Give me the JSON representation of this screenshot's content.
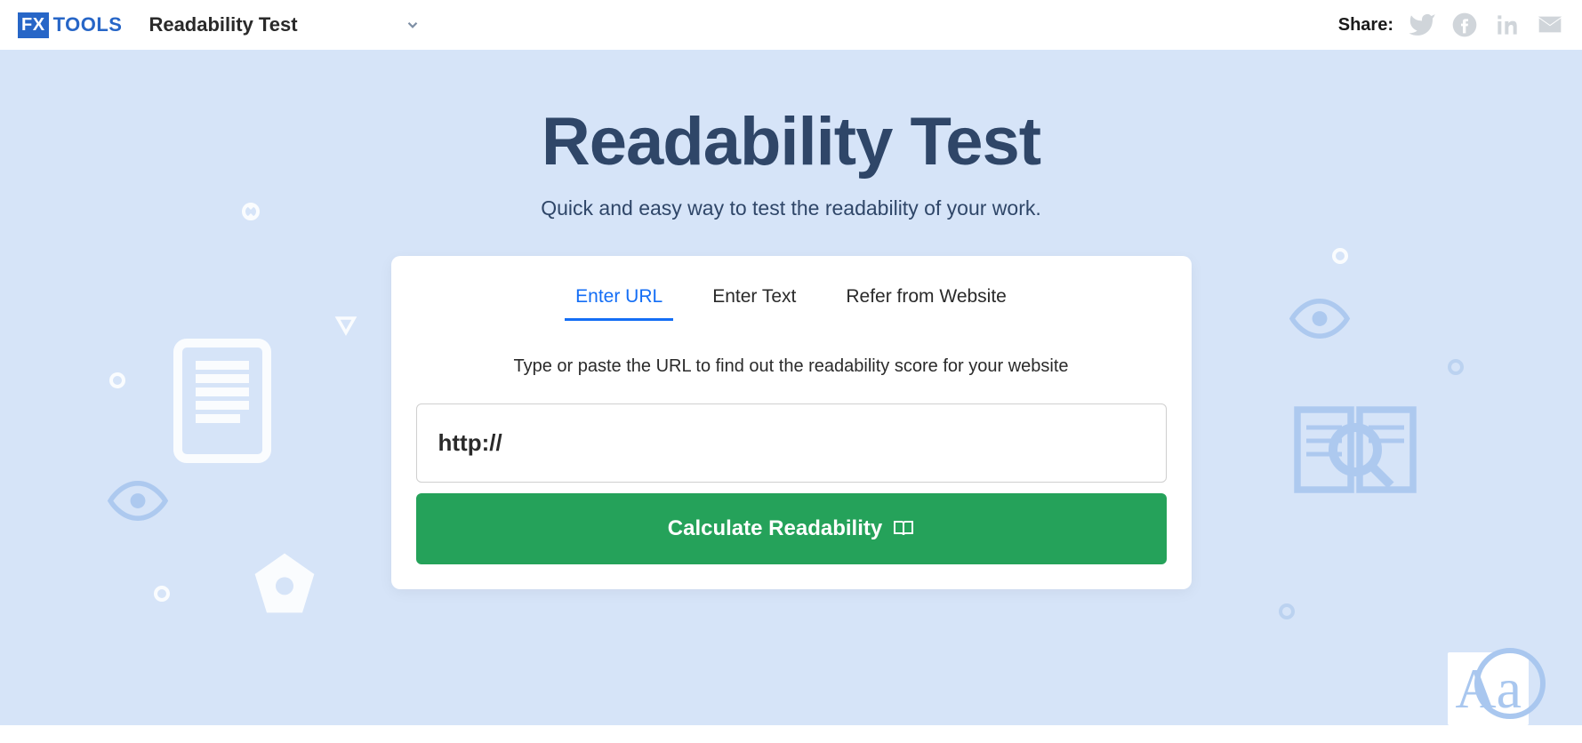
{
  "header": {
    "logo_fx": "FX",
    "logo_tools": "TOOLS",
    "page_name": "Readability Test",
    "share_label": "Share:"
  },
  "hero": {
    "title": "Readability Test",
    "subtitle": "Quick and easy way to test the readability of your work."
  },
  "card": {
    "tabs": [
      {
        "label": "Enter URL",
        "active": true
      },
      {
        "label": "Enter Text",
        "active": false
      },
      {
        "label": "Refer from Website",
        "active": false
      }
    ],
    "instruction": "Type or paste the URL to find out the readability score for your website",
    "url_value": "http://",
    "button_label": "Calculate Readability"
  }
}
